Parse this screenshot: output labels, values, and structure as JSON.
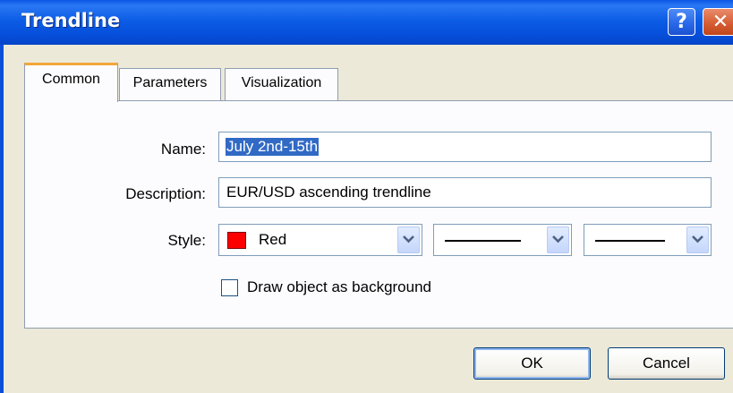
{
  "window": {
    "title": "Trendline",
    "help_label": "?",
    "close_label": "✕"
  },
  "tabs": [
    {
      "label": "Common",
      "active": true
    },
    {
      "label": "Parameters",
      "active": false
    },
    {
      "label": "Visualization",
      "active": false
    }
  ],
  "form": {
    "name_label": "Name:",
    "name_value": "July 2nd-15th",
    "description_label": "Description:",
    "description_value": "EUR/USD ascending trendline",
    "style_label": "Style:",
    "color_value": "Red",
    "color_hex": "#ff0000",
    "checkbox_label": "Draw object as background",
    "checkbox_checked": false
  },
  "buttons": {
    "ok": "OK",
    "cancel": "Cancel"
  }
}
